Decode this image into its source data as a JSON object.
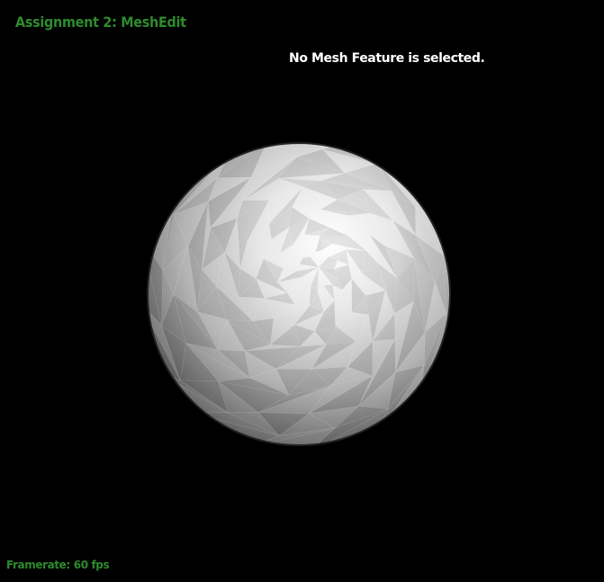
{
  "app": {
    "title": "Assignment 2: MeshEdit"
  },
  "status": {
    "selection_text": "No Mesh Feature is selected."
  },
  "footer": {
    "framerate_label": "Framerate:",
    "framerate_value": "60 fps"
  },
  "viewport": {
    "background_color": "#000000",
    "mesh_object": "sphere-mesh",
    "shading": "flat"
  },
  "colors": {
    "overlay_text_green": "#2e8b2e",
    "status_text": "#ffffff"
  }
}
